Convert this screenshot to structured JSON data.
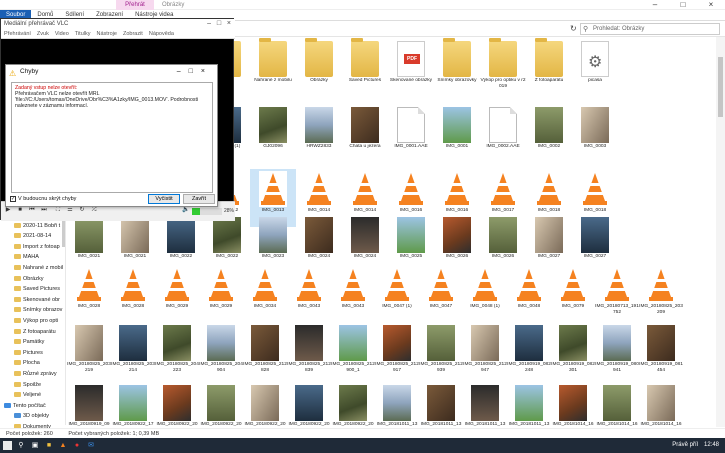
{
  "explorer": {
    "titlebar": {
      "context_tab": "Přehrát",
      "title": "Obrázky"
    },
    "ribbon": {
      "tabs": [
        "Soubor",
        "Domů",
        "Sdílení",
        "Zobrazení",
        "Nástroje videa"
      ]
    },
    "search_placeholder": "Prohledat: Obrázky",
    "nav_items": [
      {
        "label": "2020_11_16",
        "icon": "folder-icon"
      },
      {
        "label": "2020-11 Bobři t",
        "icon": "folder-icon"
      },
      {
        "label": "2021-08-14",
        "icon": "folder-icon"
      },
      {
        "label": "Import z fotoap",
        "icon": "folder-icon"
      },
      {
        "label": "MAHA",
        "icon": "folder-icon"
      },
      {
        "label": "Nahrané z mobil",
        "icon": "folder-icon"
      },
      {
        "label": "Obrázky",
        "icon": "folder-icon"
      },
      {
        "label": "Saved Pictures",
        "icon": "folder-icon"
      },
      {
        "label": "Skenované obr",
        "icon": "folder-icon"
      },
      {
        "label": "Snímky obrazov",
        "icon": "folder-icon"
      },
      {
        "label": "Výkop pro opti",
        "icon": "folder-icon"
      },
      {
        "label": "Z fotoaparátu",
        "icon": "folder-icon"
      },
      {
        "label": "Památky",
        "icon": "folder-icon"
      },
      {
        "label": "Pictures",
        "icon": "folder-icon"
      },
      {
        "label": "Plocha",
        "icon": "folder-icon"
      },
      {
        "label": "Různé zprávy",
        "icon": "folder-icon"
      },
      {
        "label": "Spoilže",
        "icon": "folder-icon"
      },
      {
        "label": "Veljené",
        "icon": "folder-icon"
      },
      {
        "label": "Tento počítač",
        "icon": "computer-icon"
      },
      {
        "label": "3D objekty",
        "icon": "cube-icon"
      },
      {
        "label": "Dokumenty",
        "icon": "folder-icon"
      }
    ],
    "rows": [
      [
        "",
        "2021-08-14",
        "Import z fotoaparátu",
        "MAHA",
        "Nahrané z mobilu",
        "Obrázky",
        "Saved Pictures",
        "Skenované obrázky",
        "Snímky obrazovky",
        "Výkop pro optiku v r2019",
        "Z fotoaparátu",
        "picasa"
      ],
      [
        "",
        "",
        "PLPL0751",
        "GJ02096 (1)",
        "GJ02096",
        "HRWZ2833",
        "Chata u jezera",
        "IMG_0001.AAE",
        "IMG_0001",
        "IMG_0002.AAE",
        "IMG_0002",
        "IMG_0003"
      ],
      [
        "",
        "IMG_0011",
        "IMG_0012",
        "IMG_0012",
        "IMG_0013",
        "IMG_0014",
        "IMG_0014",
        "IMG_0016",
        "IMG_0016",
        "IMG_0017",
        "IMG_0018",
        "IMG_0018"
      ],
      [
        "IMG_0021",
        "IMG_0021",
        "IMG_0022",
        "IMG_0022",
        "IMG_0023",
        "IMG_0024",
        "IMG_0024",
        "IMG_0025",
        "IMG_0026",
        "IMG_0026",
        "IMG_0027",
        "IMG_0027"
      ],
      [
        "IMG_0028",
        "IMG_0028",
        "IMG_0029",
        "IMG_0029",
        "IMG_0034",
        "IMG_0043",
        "IMG_0043",
        "IMG_0047 (1)",
        "IMG_0047",
        "IMG_0048 (1)",
        "IMG_0048",
        "IMG_0079",
        "IMG_20180713_191752",
        "IMG_20180825_203209"
      ],
      [
        "IMG_20180825_203219",
        "IMG_20180825_203214",
        "IMG_20180825_204223",
        "IMG_20180825_204904",
        "IMG_20180825_212828",
        "IMG_20180825_212839",
        "IMG_20180825_212900_1",
        "IMG_20180825_212917",
        "IMG_20180825_212939",
        "IMG_20180825_212947",
        "IMG_20180919_082248",
        "IMG_20180919_082301",
        "IMG_20180919_080941",
        "IMG_20180919_081454"
      ],
      [
        "IMG_20180919_09",
        "IMG_20180922_17",
        "IMG_20180922_20",
        "IMG_20180922_20",
        "IMG_20180922_20",
        "IMG_20180922_20",
        "IMG_20180922_20",
        "IMG_20181011_13",
        "IMG_20181011_13",
        "IMG_20181011_13",
        "IMG_20181011_13",
        "IMG_20181014_16",
        "IMG_20181014_16",
        "IMG_20181014_16"
      ]
    ],
    "status": {
      "item_count": "Počet položek: 260",
      "selected": "Počet vybraných položek: 1; 0,39 MB"
    }
  },
  "vlc": {
    "title": "Mediální přehrávač VLC",
    "menu": [
      "Přehrávání",
      "Zvuk",
      "Video",
      "Titulky",
      "Nástroje",
      "Zobrazit",
      "Nápověda"
    ],
    "volume_label": "28%",
    "volume": 0.28
  },
  "dialog": {
    "title": "Chyby",
    "heading": "Zadaný vstup nelze otevřít:",
    "message": "Přehrávačem VLC nelze otevřít MRL 'file:///C:/Users/tomas/OneDrive/Obr%C3%A1zky/IMG_0013.MOV'. Podrobnosti naleznete v záznamu informací.",
    "checkbox_label": "V budoucnu skrýt chyby",
    "btn_clear": "Vyčistit",
    "btn_close": "Zavřít"
  },
  "taskbar": {
    "lang": "Právě příl",
    "time": "12:48"
  }
}
